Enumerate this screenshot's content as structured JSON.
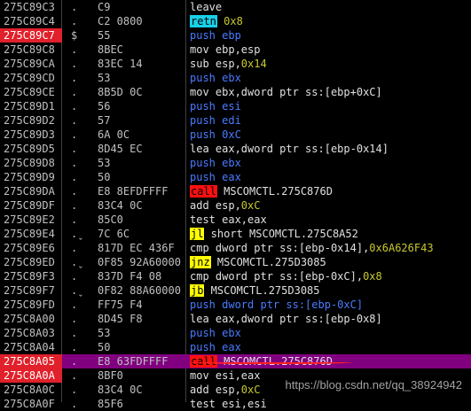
{
  "disassembly": {
    "rows": [
      {
        "address": "275C89C3",
        "marker": ".",
        "hex": "C9",
        "parts": [
          {
            "t": "leave",
            "c": "mn"
          }
        ]
      },
      {
        "address": "275C89C4",
        "marker": ".",
        "hex": "C2 0800",
        "parts": [
          {
            "t": "retn",
            "c": "mn-retn"
          },
          {
            "t": " ",
            "c": "mn"
          },
          {
            "t": "0x8",
            "c": "num"
          }
        ]
      },
      {
        "address": "275C89C7",
        "marker": "$",
        "hex": "55",
        "addr_red": true,
        "parts": [
          {
            "t": "push",
            "c": "mn-push"
          },
          {
            "t": " ebp",
            "c": "mn-push"
          }
        ]
      },
      {
        "address": "275C89C8",
        "marker": ".",
        "hex": "8BEC",
        "parts": [
          {
            "t": "mov ebp,esp",
            "c": "mn"
          }
        ]
      },
      {
        "address": "275C89CA",
        "marker": ".",
        "hex": "83EC 14",
        "parts": [
          {
            "t": "sub esp,",
            "c": "mn"
          },
          {
            "t": "0x14",
            "c": "num"
          }
        ]
      },
      {
        "address": "275C89CD",
        "marker": ".",
        "hex": "53",
        "parts": [
          {
            "t": "push ebx",
            "c": "mn-push"
          }
        ]
      },
      {
        "address": "275C89CE",
        "marker": ".",
        "hex": "8B5D 0C",
        "parts": [
          {
            "t": "mov ebx,dword ptr ss:[ebp+0xC]",
            "c": "mn"
          }
        ]
      },
      {
        "address": "275C89D1",
        "marker": ".",
        "hex": "56",
        "parts": [
          {
            "t": "push esi",
            "c": "mn-push"
          }
        ]
      },
      {
        "address": "275C89D2",
        "marker": ".",
        "hex": "57",
        "parts": [
          {
            "t": "push edi",
            "c": "mn-push"
          }
        ]
      },
      {
        "address": "275C89D3",
        "marker": ".",
        "hex": "6A 0C",
        "parts": [
          {
            "t": "push 0xC",
            "c": "mn-push"
          }
        ]
      },
      {
        "address": "275C89D5",
        "marker": ".",
        "hex": "8D45 EC",
        "parts": [
          {
            "t": "lea eax,dword ptr ss:[ebp-0x14]",
            "c": "mn"
          }
        ]
      },
      {
        "address": "275C89D8",
        "marker": ".",
        "hex": "53",
        "parts": [
          {
            "t": "push ebx",
            "c": "mn-push"
          }
        ]
      },
      {
        "address": "275C89D9",
        "marker": ".",
        "hex": "50",
        "parts": [
          {
            "t": "push eax",
            "c": "mn-push"
          }
        ]
      },
      {
        "address": "275C89DA",
        "marker": ".",
        "hex": "E8 8EFDFFFF",
        "parts": [
          {
            "t": "call",
            "c": "mn-call"
          },
          {
            "t": " MSCOMCTL.275C876D",
            "c": "mn"
          }
        ]
      },
      {
        "address": "275C89DF",
        "marker": ".",
        "hex": "83C4 0C",
        "parts": [
          {
            "t": "add esp,",
            "c": "mn"
          },
          {
            "t": "0xC",
            "c": "num"
          }
        ]
      },
      {
        "address": "275C89E2",
        "marker": ".",
        "hex": "85C0",
        "parts": [
          {
            "t": "test eax,eax",
            "c": "mn"
          }
        ]
      },
      {
        "address": "275C89E4",
        "marker": ".ˬ",
        "hex": "7C 6C",
        "parts": [
          {
            "t": "jl",
            "c": "mn-jcc"
          },
          {
            "t": " short MSCOMCTL.275C8A52",
            "c": "mn"
          }
        ]
      },
      {
        "address": "275C89E6",
        "marker": ".",
        "hex": "817D EC 436F",
        "parts": [
          {
            "t": "cmp dword ptr ss:[ebp-0x14],",
            "c": "mn"
          },
          {
            "t": "0x6A626F43",
            "c": "num"
          }
        ]
      },
      {
        "address": "275C89ED",
        "marker": ".ˬ",
        "hex": "0F85 92A60000",
        "parts": [
          {
            "t": "jnz",
            "c": "mn-jcc"
          },
          {
            "t": " MSCOMCTL.275D3085",
            "c": "mn"
          }
        ]
      },
      {
        "address": "275C89F3",
        "marker": ".",
        "hex": "837D F4 08",
        "parts": [
          {
            "t": "cmp dword ptr ss:[ebp-0xC],",
            "c": "mn"
          },
          {
            "t": "0x8",
            "c": "num"
          }
        ]
      },
      {
        "address": "275C89F7",
        "marker": ".ˬ",
        "hex": "0F82 88A60000",
        "parts": [
          {
            "t": "jb",
            "c": "mn-jcc"
          },
          {
            "t": " MSCOMCTL.275D3085",
            "c": "mn"
          }
        ]
      },
      {
        "address": "275C89FD",
        "marker": ".",
        "hex": "FF75 F4",
        "parts": [
          {
            "t": "push dword ptr ss:[ebp-0xC]",
            "c": "mn-push"
          }
        ]
      },
      {
        "address": "275C8A00",
        "marker": ".",
        "hex": "8D45 F8",
        "parts": [
          {
            "t": "lea eax,dword ptr ss:[ebp-0x8]",
            "c": "mn"
          }
        ]
      },
      {
        "address": "275C8A03",
        "marker": ".",
        "hex": "53",
        "parts": [
          {
            "t": "push ebx",
            "c": "mn-push"
          }
        ]
      },
      {
        "address": "275C8A04",
        "marker": ".",
        "hex": "50",
        "parts": [
          {
            "t": "push eax",
            "c": "mn-push"
          }
        ]
      },
      {
        "address": "275C8A05",
        "marker": ".",
        "hex": "E8 63FDFFFF",
        "selected": true,
        "addr_red": true,
        "parts": [
          {
            "t": "call",
            "c": "mn-call"
          },
          {
            "t": " MSCOMCTL.275C876D",
            "c": "mn"
          }
        ]
      },
      {
        "address": "275C8A0A",
        "marker": ".",
        "hex": "8BF0",
        "addr_red": true,
        "parts": [
          {
            "t": "mov esi,eax",
            "c": "mn"
          }
        ]
      },
      {
        "address": "275C8A0C",
        "marker": ".",
        "hex": "83C4 0C",
        "parts": [
          {
            "t": "add esp,",
            "c": "mn"
          },
          {
            "t": "0xC",
            "c": "num"
          }
        ]
      },
      {
        "address": "275C8A0F",
        "marker": ".",
        "hex": "85F6",
        "parts": [
          {
            "t": "test esi,esi",
            "c": "mn"
          }
        ]
      }
    ]
  },
  "watermark": "https://blog.csdn.net/qq_38924942"
}
